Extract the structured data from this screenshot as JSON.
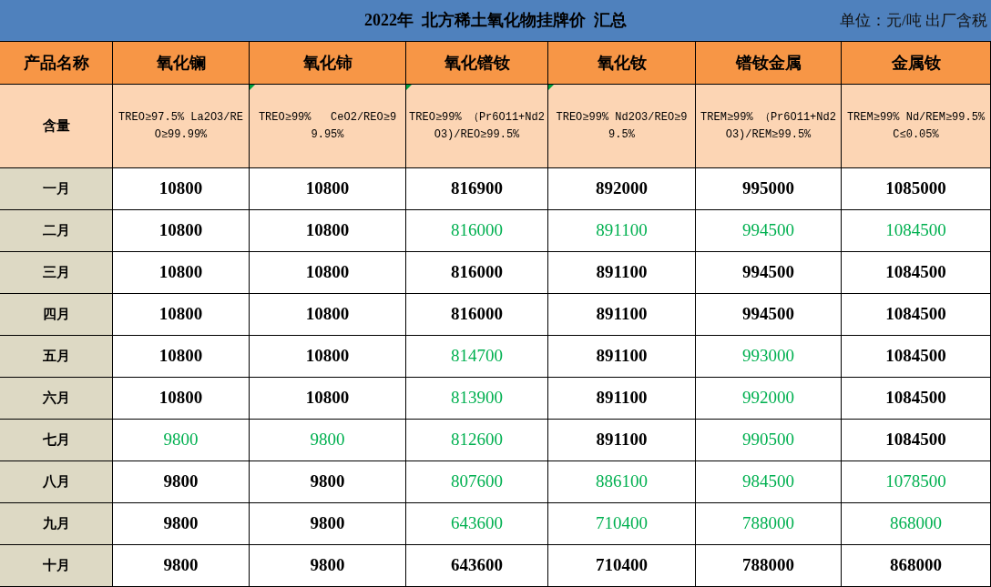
{
  "title": "2022年  北方稀土氧化物挂牌价  汇总",
  "unit": "单位：元/吨 出厂含税",
  "header": {
    "label": "产品名称",
    "columns": [
      "氧化镧",
      "氧化铈",
      "氧化镨钕",
      "氧化钕",
      "镨钕金属",
      "金属钕"
    ]
  },
  "spec": {
    "label": "含量",
    "cells": [
      {
        "text": "TREO≥97.5% La2O3/REO≥99.99%",
        "flagged": false
      },
      {
        "text": "TREO≥99%   CeO2/REO≥99.95%",
        "flagged": true
      },
      {
        "text": "TREO≥99% （Pr6O11+Nd2O3)/REO≥99.5%",
        "flagged": true
      },
      {
        "text": "TREO≥99% Nd2O3/REO≥99.5%",
        "flagged": true
      },
      {
        "text": "TREM≥99% （Pr6O11+Nd2O3)/REM≥99.5%",
        "flagged": false
      },
      {
        "text": "TREM≥99% Nd/REM≥99.5%    C≤0.05%",
        "flagged": false
      }
    ]
  },
  "rows": [
    {
      "month": "一月",
      "cells": [
        {
          "value": "10800",
          "down": false
        },
        {
          "value": "10800",
          "down": false
        },
        {
          "value": "816900",
          "down": false
        },
        {
          "value": "892000",
          "down": false
        },
        {
          "value": "995000",
          "down": false
        },
        {
          "value": "1085000",
          "down": false
        }
      ]
    },
    {
      "month": "二月",
      "cells": [
        {
          "value": "10800",
          "down": false
        },
        {
          "value": "10800",
          "down": false
        },
        {
          "value": "816000",
          "down": true
        },
        {
          "value": "891100",
          "down": true
        },
        {
          "value": "994500",
          "down": true
        },
        {
          "value": "1084500",
          "down": true
        }
      ]
    },
    {
      "month": "三月",
      "cells": [
        {
          "value": "10800",
          "down": false
        },
        {
          "value": "10800",
          "down": false
        },
        {
          "value": "816000",
          "down": false
        },
        {
          "value": "891100",
          "down": false
        },
        {
          "value": "994500",
          "down": false
        },
        {
          "value": "1084500",
          "down": false
        }
      ]
    },
    {
      "month": "四月",
      "cells": [
        {
          "value": "10800",
          "down": false
        },
        {
          "value": "10800",
          "down": false
        },
        {
          "value": "816000",
          "down": false
        },
        {
          "value": "891100",
          "down": false
        },
        {
          "value": "994500",
          "down": false
        },
        {
          "value": "1084500",
          "down": false
        }
      ]
    },
    {
      "month": "五月",
      "cells": [
        {
          "value": "10800",
          "down": false
        },
        {
          "value": "10800",
          "down": false
        },
        {
          "value": "814700",
          "down": true
        },
        {
          "value": "891100",
          "down": false
        },
        {
          "value": "993000",
          "down": true
        },
        {
          "value": "1084500",
          "down": false
        }
      ]
    },
    {
      "month": "六月",
      "cells": [
        {
          "value": "10800",
          "down": false
        },
        {
          "value": "10800",
          "down": false
        },
        {
          "value": "813900",
          "down": true
        },
        {
          "value": "891100",
          "down": false
        },
        {
          "value": "992000",
          "down": true
        },
        {
          "value": "1084500",
          "down": false
        }
      ]
    },
    {
      "month": "七月",
      "cells": [
        {
          "value": "9800",
          "down": true
        },
        {
          "value": "9800",
          "down": true
        },
        {
          "value": "812600",
          "down": true
        },
        {
          "value": "891100",
          "down": false
        },
        {
          "value": "990500",
          "down": true
        },
        {
          "value": "1084500",
          "down": false
        }
      ]
    },
    {
      "month": "八月",
      "cells": [
        {
          "value": "9800",
          "down": false
        },
        {
          "value": "9800",
          "down": false
        },
        {
          "value": "807600",
          "down": true
        },
        {
          "value": "886100",
          "down": true
        },
        {
          "value": "984500",
          "down": true
        },
        {
          "value": "1078500",
          "down": true
        }
      ]
    },
    {
      "month": "九月",
      "cells": [
        {
          "value": "9800",
          "down": false
        },
        {
          "value": "9800",
          "down": false
        },
        {
          "value": "643600",
          "down": true
        },
        {
          "value": "710400",
          "down": true
        },
        {
          "value": "788000",
          "down": true
        },
        {
          "value": "868000",
          "down": true
        }
      ]
    },
    {
      "month": "十月",
      "cells": [
        {
          "value": "9800",
          "down": false
        },
        {
          "value": "9800",
          "down": false
        },
        {
          "value": "643600",
          "down": false
        },
        {
          "value": "710400",
          "down": false
        },
        {
          "value": "788000",
          "down": false
        },
        {
          "value": "868000",
          "down": false
        }
      ]
    }
  ]
}
